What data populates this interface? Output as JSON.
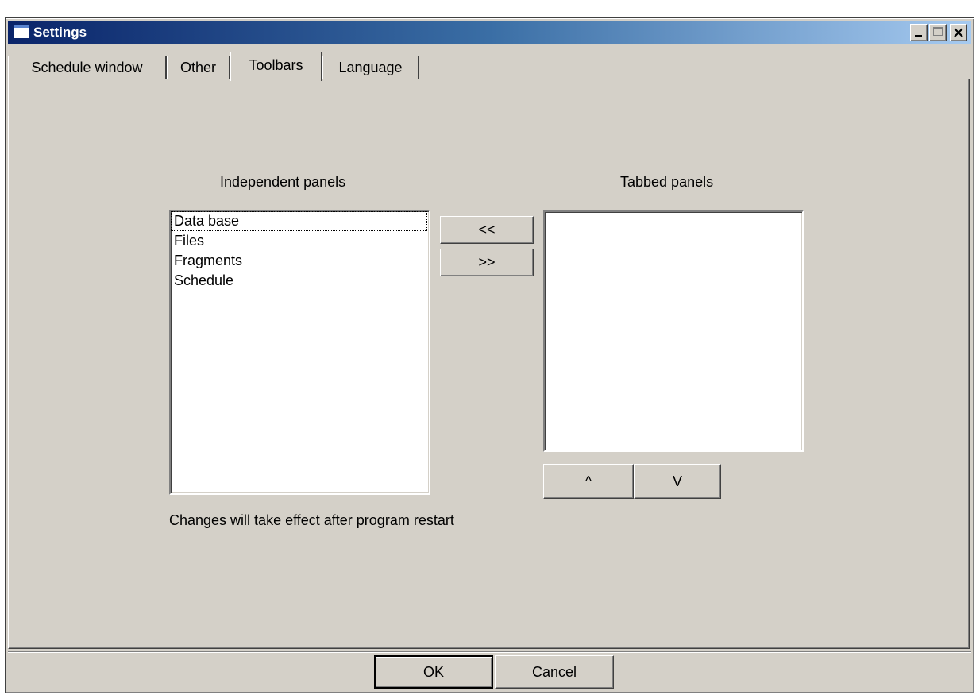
{
  "window": {
    "title": "Settings"
  },
  "tabs": [
    {
      "label": "Schedule window",
      "active": false
    },
    {
      "label": "Other",
      "active": false
    },
    {
      "label": "Toolbars",
      "active": true
    },
    {
      "label": "Language",
      "active": false
    }
  ],
  "toolbars": {
    "independent": {
      "heading": "Independent panels",
      "items": [
        "Data base",
        "Files",
        "Fragments",
        "Schedule"
      ],
      "focused_index": 0
    },
    "tabbed": {
      "heading": "Tabbed panels",
      "items": []
    },
    "move_left_label": "<<",
    "move_right_label": ">>",
    "move_up_label": "^",
    "move_down_label": "V",
    "note": "Changes will take effect after program restart"
  },
  "footer": {
    "ok_label": "OK",
    "cancel_label": "Cancel"
  },
  "colors": {
    "face": "#d4d0c8",
    "title_start": "#0a246a",
    "title_end": "#a6caf0"
  }
}
